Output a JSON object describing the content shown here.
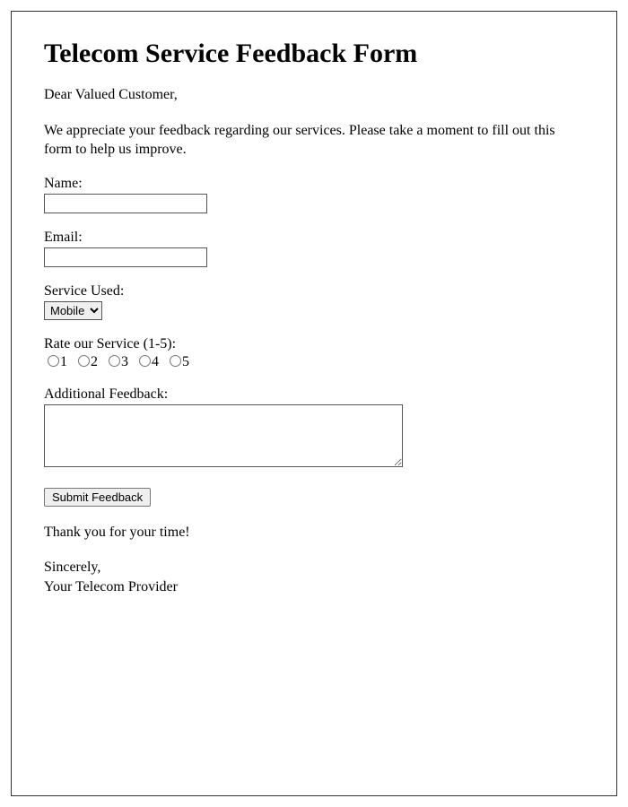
{
  "title": "Telecom Service Feedback Form",
  "greeting": "Dear Valued Customer,",
  "intro": "We appreciate your feedback regarding our services. Please take a moment to fill out this form to help us improve.",
  "fields": {
    "name": {
      "label": "Name:",
      "value": ""
    },
    "email": {
      "label": "Email:",
      "value": ""
    },
    "service": {
      "label": "Service Used:",
      "selected": "Mobile",
      "options": [
        "Mobile"
      ]
    },
    "rating": {
      "label": "Rate our Service (1-5):",
      "options": [
        "1",
        "2",
        "3",
        "4",
        "5"
      ]
    },
    "feedback": {
      "label": "Additional Feedback:",
      "value": ""
    }
  },
  "submit_label": "Submit Feedback",
  "thanks": "Thank you for your time!",
  "sign_off_1": "Sincerely,",
  "sign_off_2": "Your Telecom Provider"
}
